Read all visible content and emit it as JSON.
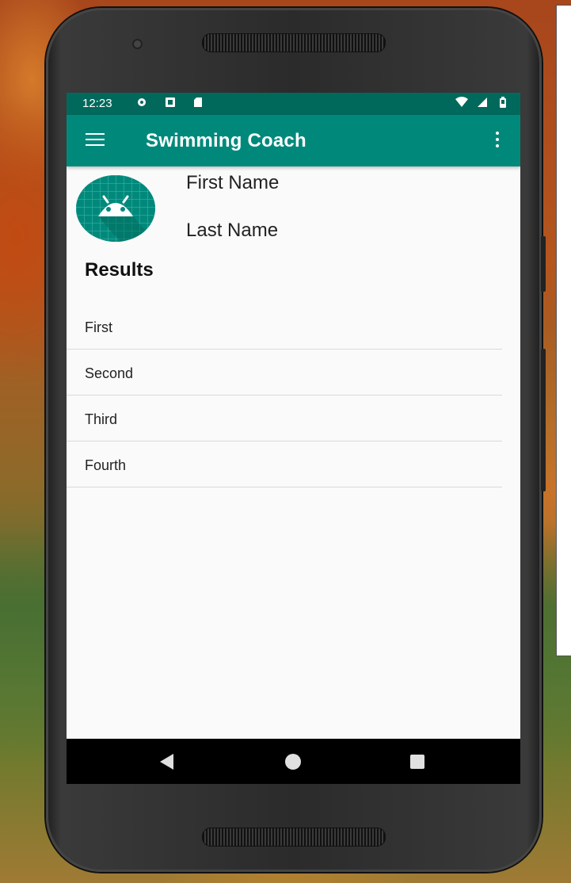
{
  "status_bar": {
    "time": "12:23",
    "left_icons": [
      "gear-icon",
      "notification-a-icon",
      "sd-card-icon"
    ],
    "right_icons": [
      "wifi-icon",
      "signal-icon",
      "battery-icon"
    ]
  },
  "app_bar": {
    "title": "Swimming Coach",
    "menu_icon": "hamburger-menu-icon",
    "overflow_icon": "vertical-dots-icon"
  },
  "profile": {
    "avatar_icon": "android-robot-icon",
    "first_name": "First Name",
    "last_name": "Last Name"
  },
  "results": {
    "heading": "Results",
    "items": [
      "First",
      "Second",
      "Third",
      "Fourth"
    ]
  },
  "navigation": {
    "back_icon": "back-triangle-icon",
    "home_icon": "home-circle-icon",
    "recents_icon": "recents-square-icon"
  },
  "colors": {
    "primary": "#00897b",
    "primary_dark": "#00695c",
    "background": "#fafafa",
    "nav_bar": "#000000"
  }
}
